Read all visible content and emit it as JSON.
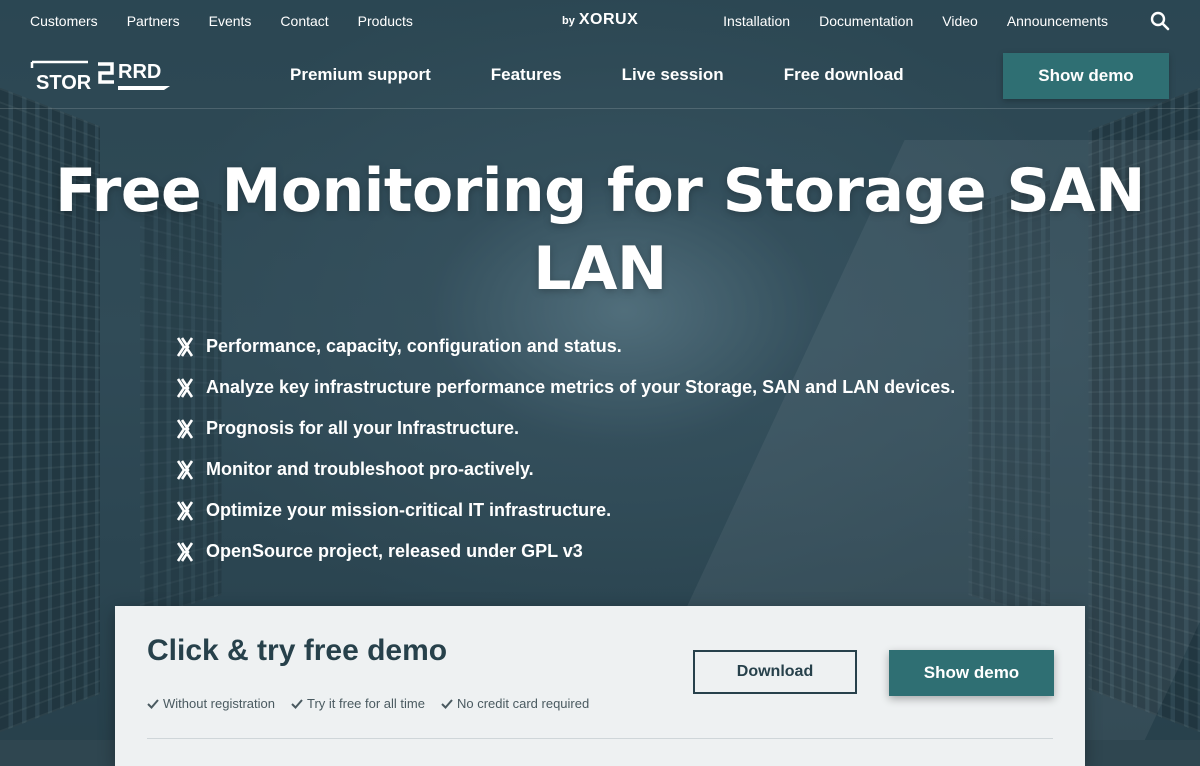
{
  "topbar": {
    "left_links": [
      "Customers",
      "Partners",
      "Events",
      "Contact",
      "Products"
    ],
    "brand_by": "by",
    "brand_name": "XORUX",
    "right_links": [
      "Installation",
      "Documentation",
      "Video",
      "Announcements"
    ],
    "search_icon": "search-icon"
  },
  "logo": {
    "text_left": "STOR",
    "text_right": "RRD"
  },
  "nav": {
    "links": [
      "Premium support",
      "Features",
      "Live session",
      "Free download"
    ],
    "cta_label": "Show demo"
  },
  "hero": {
    "title": "Free Monitoring for Storage SAN LAN",
    "bullet_icon": "xorux-x-icon",
    "features": [
      "Performance, capacity, configuration and status.",
      "Analyze key infrastructure performance metrics of your Storage, SAN and LAN devices.",
      "Prognosis for all your Infrastructure.",
      "Monitor and troubleshoot pro-actively.",
      "Optimize your mission-critical IT infrastructure.",
      "OpenSource project, released under GPL v3"
    ]
  },
  "cta": {
    "title": "Click & try free demo",
    "checks": [
      "Without registration",
      "Try it free for all time",
      "No credit card required"
    ],
    "download_label": "Download",
    "demo_label": "Show demo"
  },
  "colors": {
    "accent": "#2f6f73",
    "dark_text": "#27414b",
    "card_bg": "#eef1f2"
  }
}
